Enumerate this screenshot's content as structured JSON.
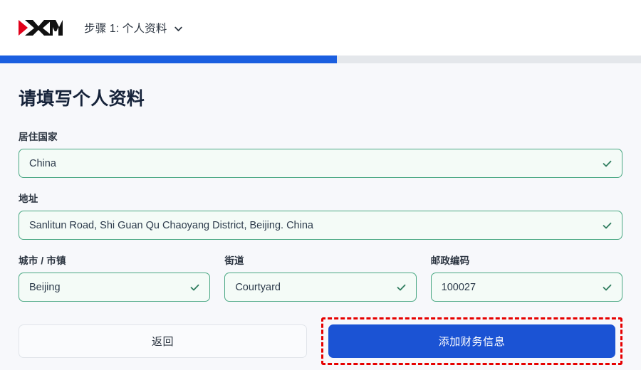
{
  "header": {
    "logo_text": "XM",
    "logo_colors": {
      "mark": "#e2001a",
      "wordmark": "#111111"
    },
    "step_label": "步骤 1: 个人资料",
    "chevron_icon": "chevron-down-icon"
  },
  "progress": {
    "percent": 52.5,
    "fill_color": "#1b5fe0",
    "track_color": "#e4e7eb"
  },
  "main": {
    "title": "请填写个人资料",
    "fields": [
      {
        "label": "居住国家",
        "value": "China",
        "placeholder": "居住国家",
        "valid": true,
        "name": "country-of-residence"
      },
      {
        "label": "地址",
        "value": "Sanlitun Road, Shi Guan Qu Chaoyang District, Beijing. China",
        "placeholder": "地址",
        "valid": true,
        "name": "address"
      },
      {
        "label": "城市 / 市镇",
        "value": "Beijing",
        "placeholder": "城市 / 市镇",
        "valid": true,
        "name": "city"
      },
      {
        "label": "街道",
        "value": "Courtyard",
        "placeholder": "街道",
        "valid": true,
        "name": "street"
      },
      {
        "label": "邮政编码",
        "value": "100027",
        "placeholder": "邮政编码",
        "valid": true,
        "name": "postal-code"
      }
    ],
    "check_icon": "check-icon",
    "check_color": "#2f7d5f"
  },
  "actions": {
    "back_label": "返回",
    "submit_label": "添加财务信息",
    "submit_color": "#1b53d4",
    "highlight_color": "#e60000"
  }
}
